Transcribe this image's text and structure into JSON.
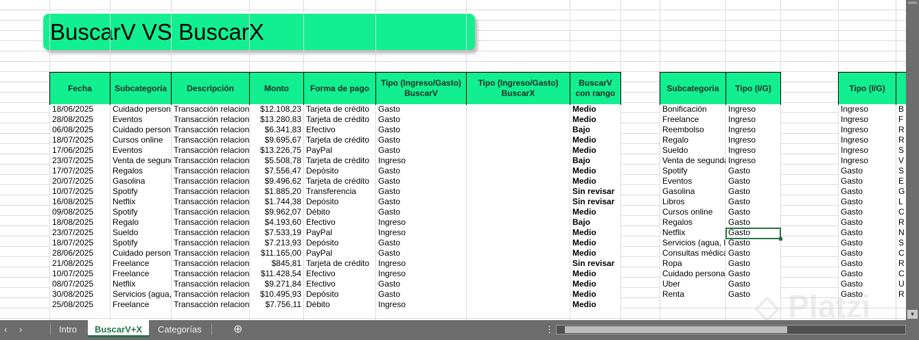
{
  "title": "BuscarV VS BuscarX",
  "headers": [
    "Fecha",
    "Subcategoría",
    "Descripción",
    "Monto",
    "Forma de pago",
    "Tipo (Ingreso/Gasto)\nBuscarV",
    "Tipo (Ingreso/Gasto)\nBuscarX",
    "BuscarV\ncon rango"
  ],
  "rows": [
    [
      "18/06/2025",
      "Cuidado personal",
      "Transacción relacionada",
      "$12.108,23",
      "Tarjeta de crédito",
      "Gasto",
      "",
      "Medio"
    ],
    [
      "28/08/2025",
      "Eventos",
      "Transacción relacionada",
      "$13.280,83",
      "Tarjeta de crédito",
      "Gasto",
      "",
      "Medio"
    ],
    [
      "06/08/2025",
      "Cuidado personal",
      "Transacción relacionada",
      "$6.341,83",
      "Efectivo",
      "Gasto",
      "",
      "Bajo"
    ],
    [
      "18/07/2025",
      "Cursos online",
      "Transacción relacionada",
      "$9.695,67",
      "Tarjeta de crédito",
      "Gasto",
      "",
      "Medio"
    ],
    [
      "17/06/2025",
      "Eventos",
      "Transacción relacionada",
      "$13.226,75",
      "PayPal",
      "Gasto",
      "",
      "Medio"
    ],
    [
      "23/07/2025",
      "Venta de segunda",
      "Transacción relacionada",
      "$5.508,78",
      "Tarjeta de crédito",
      "Ingreso",
      "",
      "Bajo"
    ],
    [
      "17/07/2025",
      "Regalos",
      "Transacción relacionada",
      "$7.556,47",
      "Depósito",
      "Gasto",
      "",
      "Medio"
    ],
    [
      "20/07/2025",
      "Gasolina",
      "Transacción relacionada",
      "$9.496,62",
      "Tarjeta de crédito",
      "Gasto",
      "",
      "Medio"
    ],
    [
      "10/07/2025",
      "Spotify",
      "Transacción relacionada",
      "$1.885,20",
      "Transferencia",
      "Gasto",
      "",
      "Sin revisar"
    ],
    [
      "16/08/2025",
      "Netflix",
      "Transacción relacionada",
      "$1.744,38",
      "Depósito",
      "Gasto",
      "",
      "Sin revisar"
    ],
    [
      "09/08/2025",
      "Spotify",
      "Transacción relacionada",
      "$9.962,07",
      "Débito",
      "Gasto",
      "",
      "Medio"
    ],
    [
      "18/08/2025",
      "Regalo",
      "Transacción relacionada",
      "$4.193,60",
      "Efectivo",
      "Ingreso",
      "",
      "Bajo"
    ],
    [
      "23/07/2025",
      "Sueldo",
      "Transacción relacionada",
      "$7.533,19",
      "PayPal",
      "Ingreso",
      "",
      "Medio"
    ],
    [
      "18/07/2025",
      "Spotify",
      "Transacción relacionada",
      "$7.213,93",
      "Depósito",
      "Gasto",
      "",
      "Medio"
    ],
    [
      "28/06/2025",
      "Cuidado personal",
      "Transacción relacionada",
      "$11.165,00",
      "PayPal",
      "Gasto",
      "",
      "Medio"
    ],
    [
      "21/08/2025",
      "Freelance",
      "Transacción relacionada",
      "$845,81",
      "Tarjeta de crédito",
      "Ingreso",
      "",
      "Sin revisar"
    ],
    [
      "10/07/2025",
      "Freelance",
      "Transacción relacionada",
      "$11.428,54",
      "Efectivo",
      "Ingreso",
      "",
      "Medio"
    ],
    [
      "08/07/2025",
      "Netflix",
      "Transacción relacionada",
      "$9.271,84",
      "Efectivo",
      "Gasto",
      "",
      "Medio"
    ],
    [
      "30/08/2025",
      "Servicios (agua, luz)",
      "Transacción relacionada",
      "$10.495,93",
      "Depósito",
      "Gasto",
      "",
      "Medio"
    ],
    [
      "25/08/2025",
      "Freelance",
      "Transacción relacionada",
      "$7.756,11",
      "Débito",
      "Ingreso",
      "",
      "Medio"
    ]
  ],
  "lookup_headers": [
    "Subcategoria",
    "Tipo (I/G)"
  ],
  "lookup": [
    [
      "Bonificación",
      "Ingreso"
    ],
    [
      "Freelance",
      "Ingreso"
    ],
    [
      "Reembolso",
      "Ingreso"
    ],
    [
      "Regalo",
      "Ingreso"
    ],
    [
      "Sueldo",
      "Ingreso"
    ],
    [
      "Venta de segunda",
      "Ingreso"
    ],
    [
      "Spotify",
      "Gasto"
    ],
    [
      "Eventos",
      "Gasto"
    ],
    [
      "Gasolina",
      "Gasto"
    ],
    [
      "Libros",
      "Gasto"
    ],
    [
      "Cursos online",
      "Gasto"
    ],
    [
      "Regalos",
      "Gasto"
    ],
    [
      "Netflix",
      "Gasto"
    ],
    [
      "Servicios (agua, luz)",
      "Gasto"
    ],
    [
      "Consultas médicas",
      "Gasto"
    ],
    [
      "Ropa",
      "Gasto"
    ],
    [
      "Cuidado personal",
      "Gasto"
    ],
    [
      "Uber",
      "Gasto"
    ],
    [
      "Renta",
      "Gasto"
    ]
  ],
  "lookup2_header": "Tipo (I/G)",
  "lookup2": [
    [
      "Ingreso",
      "B"
    ],
    [
      "Ingreso",
      "F"
    ],
    [
      "Ingreso",
      "R"
    ],
    [
      "Ingreso",
      "R"
    ],
    [
      "Ingreso",
      "S"
    ],
    [
      "Ingreso",
      "V"
    ],
    [
      "Gasto",
      "S"
    ],
    [
      "Gasto",
      "E"
    ],
    [
      "Gasto",
      "G"
    ],
    [
      "Gasto",
      "L"
    ],
    [
      "Gasto",
      "C"
    ],
    [
      "Gasto",
      "R"
    ],
    [
      "Gasto",
      "N"
    ],
    [
      "Gasto",
      "S"
    ],
    [
      "Gasto",
      "C"
    ],
    [
      "Gasto",
      "R"
    ],
    [
      "Gasto",
      "C"
    ],
    [
      "Gasto",
      "U"
    ],
    [
      "Gasto",
      "R"
    ]
  ],
  "tabs": [
    "Intro",
    "BuscarV+X",
    "Categorías"
  ],
  "active_tab": "BuscarV+X",
  "watermark": "Platzi"
}
